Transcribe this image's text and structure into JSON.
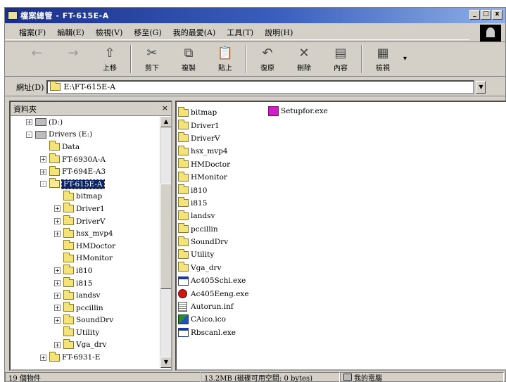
{
  "window": {
    "title": "檔案總管 - FT-615E-A",
    "controls": [
      "_",
      "□",
      "x"
    ]
  },
  "menu": [
    "檔案(F)",
    "編輯(E)",
    "檢視(V)",
    "移至(G)",
    "我的最愛(A)",
    "工具(T)",
    "說明(H)"
  ],
  "toolbar": {
    "buttons": [
      {
        "icon": "back-arrow-icon",
        "glyph": "←",
        "label": ""
      },
      {
        "icon": "forward-arrow-icon",
        "glyph": "→",
        "label": ""
      },
      {
        "icon": "up-folder-icon",
        "glyph": "⇧",
        "label": "上移"
      },
      {
        "icon": "cut-icon",
        "glyph": "✂",
        "label": "剪下"
      },
      {
        "icon": "copy-icon",
        "glyph": "⧉",
        "label": "複製"
      },
      {
        "icon": "paste-icon",
        "glyph": "📋",
        "label": "貼上"
      },
      {
        "icon": "undo-icon",
        "glyph": "↶",
        "label": "復原"
      },
      {
        "icon": "delete-icon",
        "glyph": "✕",
        "label": "刪除"
      },
      {
        "icon": "properties-icon",
        "glyph": "▤",
        "label": "內容"
      },
      {
        "icon": "views-icon",
        "glyph": "▦",
        "label": "檢視"
      }
    ]
  },
  "address": {
    "label": "網址(D)",
    "value": "E:\\FT-615E-A"
  },
  "folders_panel": {
    "title": "資料夾",
    "close": "×",
    "tree": [
      {
        "label": "(D:)",
        "expander": "+",
        "kind": "drive",
        "indent": 0
      },
      {
        "label": "Drivers (E:)",
        "expander": "-",
        "kind": "drive",
        "indent": 0
      },
      {
        "label": "Data",
        "expander": "",
        "kind": "folder",
        "indent": 1
      },
      {
        "label": "FT-6930A-A",
        "expander": "+",
        "kind": "folder",
        "indent": 1
      },
      {
        "label": "FT-694E-A3",
        "expander": "+",
        "kind": "folder",
        "indent": 1
      },
      {
        "label": "FT-615E-A",
        "expander": "-",
        "kind": "folder-open",
        "indent": 1,
        "selected": true
      },
      {
        "label": "bitmap",
        "expander": "",
        "kind": "folder",
        "indent": 2
      },
      {
        "label": "Driver1",
        "expander": "+",
        "kind": "folder",
        "indent": 2
      },
      {
        "label": "DriverV",
        "expander": "+",
        "kind": "folder",
        "indent": 2
      },
      {
        "label": "hsx_mvp4",
        "expander": "+",
        "kind": "folder",
        "indent": 2
      },
      {
        "label": "HMDoctor",
        "expander": "",
        "kind": "folder",
        "indent": 2
      },
      {
        "label": "HMonitor",
        "expander": "",
        "kind": "folder",
        "indent": 2
      },
      {
        "label": "i810",
        "expander": "+",
        "kind": "folder",
        "indent": 2
      },
      {
        "label": "i815",
        "expander": "+",
        "kind": "folder",
        "indent": 2
      },
      {
        "label": "landsv",
        "expander": "+",
        "kind": "folder",
        "indent": 2
      },
      {
        "label": "pccillin",
        "expander": "+",
        "kind": "folder",
        "indent": 2
      },
      {
        "label": "SoundDrv",
        "expander": "+",
        "kind": "folder",
        "indent": 2
      },
      {
        "label": "Utility",
        "expander": "",
        "kind": "folder",
        "indent": 2
      },
      {
        "label": "Vga_drv",
        "expander": "+",
        "kind": "folder",
        "indent": 2
      },
      {
        "label": "FT-6931-E",
        "expander": "+",
        "kind": "folder",
        "indent": 1
      }
    ]
  },
  "files": [
    {
      "name": "bitmap",
      "type": "folder"
    },
    {
      "name": "Driver1",
      "type": "folder"
    },
    {
      "name": "DriverV",
      "type": "folder"
    },
    {
      "name": "hsx_mvp4",
      "type": "folder"
    },
    {
      "name": "HMDoctor",
      "type": "folder"
    },
    {
      "name": "HMonitor",
      "type": "folder"
    },
    {
      "name": "i810",
      "type": "folder"
    },
    {
      "name": "i815",
      "type": "folder"
    },
    {
      "name": "landsv",
      "type": "folder"
    },
    {
      "name": "pccillin",
      "type": "folder"
    },
    {
      "name": "SoundDrv",
      "type": "folder"
    },
    {
      "name": "Utility",
      "type": "folder"
    },
    {
      "name": "Vga_drv",
      "type": "folder"
    },
    {
      "name": "Ac405Schi.exe",
      "type": "exe"
    },
    {
      "name": "Ac405Eeng.exe",
      "type": "exe-red"
    },
    {
      "name": "Autorun.inf",
      "type": "inf"
    },
    {
      "name": "CAico.ico",
      "type": "ico"
    },
    {
      "name": "Rbscanl.exe",
      "type": "exe"
    }
  ],
  "setup_file": {
    "name": "Setupfor.exe",
    "type": "setup"
  },
  "status": {
    "objects": "19 個物件",
    "disk": "13.2MB (磁碟可用空間: 0 bytes)",
    "location": "我的電腦"
  }
}
